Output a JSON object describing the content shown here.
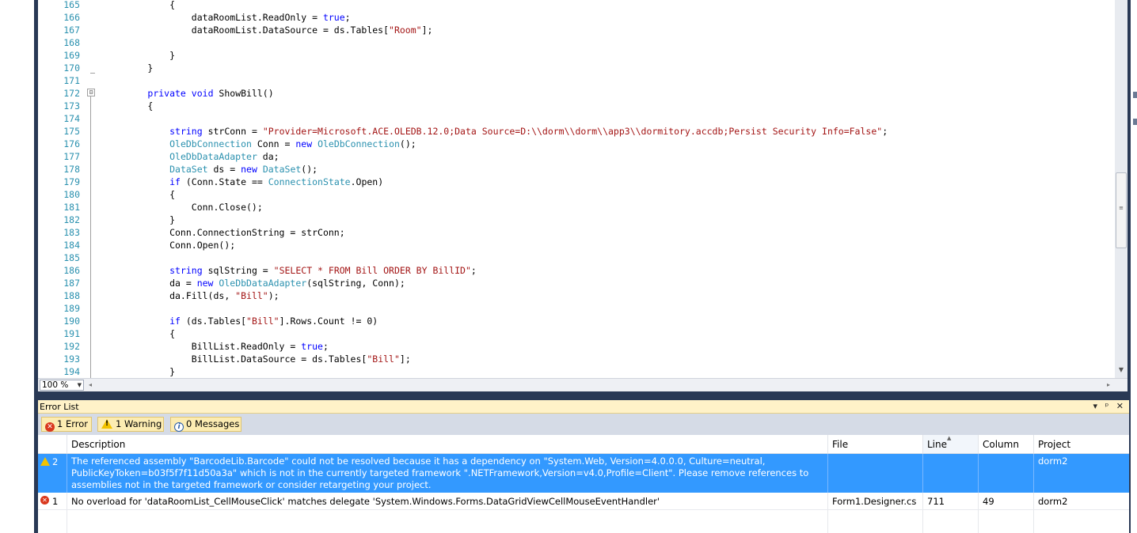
{
  "editor": {
    "lines": [
      {
        "n": "165",
        "tokens": [
          {
            "t": "            {",
            "c": "plain"
          }
        ]
      },
      {
        "n": "166",
        "tokens": [
          {
            "t": "                dataRoomList.ReadOnly = ",
            "c": "plain"
          },
          {
            "t": "true",
            "c": "kw"
          },
          {
            "t": ";",
            "c": "plain"
          }
        ]
      },
      {
        "n": "167",
        "tokens": [
          {
            "t": "                dataRoomList.DataSource = ds.Tables[",
            "c": "plain"
          },
          {
            "t": "\"Room\"",
            "c": "st"
          },
          {
            "t": "];",
            "c": "plain"
          }
        ]
      },
      {
        "n": "168",
        "tokens": []
      },
      {
        "n": "169",
        "tokens": [
          {
            "t": "            }",
            "c": "plain"
          }
        ]
      },
      {
        "n": "170",
        "tokens": [
          {
            "t": "        }",
            "c": "plain"
          }
        ]
      },
      {
        "n": "171",
        "tokens": []
      },
      {
        "n": "172",
        "tokens": [
          {
            "t": "        ",
            "c": "plain"
          },
          {
            "t": "private",
            "c": "kw"
          },
          {
            "t": " ",
            "c": "plain"
          },
          {
            "t": "void",
            "c": "kw"
          },
          {
            "t": " ShowBill()",
            "c": "plain"
          }
        ]
      },
      {
        "n": "173",
        "tokens": [
          {
            "t": "        {",
            "c": "plain"
          }
        ]
      },
      {
        "n": "174",
        "tokens": []
      },
      {
        "n": "175",
        "tokens": [
          {
            "t": "            ",
            "c": "plain"
          },
          {
            "t": "string",
            "c": "kw"
          },
          {
            "t": " strConn = ",
            "c": "plain"
          },
          {
            "t": "\"Provider=Microsoft.ACE.OLEDB.12.0;Data Source=D:\\\\dorm\\\\dorm\\\\app3\\\\dormitory.accdb;Persist Security Info=False\"",
            "c": "st"
          },
          {
            "t": ";",
            "c": "plain"
          }
        ]
      },
      {
        "n": "176",
        "tokens": [
          {
            "t": "            ",
            "c": "plain"
          },
          {
            "t": "OleDbConnection",
            "c": "ty"
          },
          {
            "t": " Conn = ",
            "c": "plain"
          },
          {
            "t": "new",
            "c": "kw"
          },
          {
            "t": " ",
            "c": "plain"
          },
          {
            "t": "OleDbConnection",
            "c": "ty"
          },
          {
            "t": "();",
            "c": "plain"
          }
        ]
      },
      {
        "n": "177",
        "tokens": [
          {
            "t": "            ",
            "c": "plain"
          },
          {
            "t": "OleDbDataAdapter",
            "c": "ty"
          },
          {
            "t": " da;",
            "c": "plain"
          }
        ]
      },
      {
        "n": "178",
        "tokens": [
          {
            "t": "            ",
            "c": "plain"
          },
          {
            "t": "DataSet",
            "c": "ty"
          },
          {
            "t": " ds = ",
            "c": "plain"
          },
          {
            "t": "new",
            "c": "kw"
          },
          {
            "t": " ",
            "c": "plain"
          },
          {
            "t": "DataSet",
            "c": "ty"
          },
          {
            "t": "();",
            "c": "plain"
          }
        ]
      },
      {
        "n": "179",
        "tokens": [
          {
            "t": "            ",
            "c": "plain"
          },
          {
            "t": "if",
            "c": "kw"
          },
          {
            "t": " (Conn.State == ",
            "c": "plain"
          },
          {
            "t": "ConnectionState",
            "c": "ty"
          },
          {
            "t": ".Open)",
            "c": "plain"
          }
        ]
      },
      {
        "n": "180",
        "tokens": [
          {
            "t": "            {",
            "c": "plain"
          }
        ]
      },
      {
        "n": "181",
        "tokens": [
          {
            "t": "                Conn.Close();",
            "c": "plain"
          }
        ]
      },
      {
        "n": "182",
        "tokens": [
          {
            "t": "            }",
            "c": "plain"
          }
        ]
      },
      {
        "n": "183",
        "tokens": [
          {
            "t": "            Conn.ConnectionString = strConn;",
            "c": "plain"
          }
        ]
      },
      {
        "n": "184",
        "tokens": [
          {
            "t": "            Conn.Open();",
            "c": "plain"
          }
        ]
      },
      {
        "n": "185",
        "tokens": []
      },
      {
        "n": "186",
        "tokens": [
          {
            "t": "            ",
            "c": "plain"
          },
          {
            "t": "string",
            "c": "kw"
          },
          {
            "t": " sqlString = ",
            "c": "plain"
          },
          {
            "t": "\"SELECT * FROM Bill ORDER BY BillID\"",
            "c": "st"
          },
          {
            "t": ";",
            "c": "plain"
          }
        ]
      },
      {
        "n": "187",
        "tokens": [
          {
            "t": "            da = ",
            "c": "plain"
          },
          {
            "t": "new",
            "c": "kw"
          },
          {
            "t": " ",
            "c": "plain"
          },
          {
            "t": "OleDbDataAdapter",
            "c": "ty"
          },
          {
            "t": "(sqlString, Conn);",
            "c": "plain"
          }
        ]
      },
      {
        "n": "188",
        "tokens": [
          {
            "t": "            da.Fill(ds, ",
            "c": "plain"
          },
          {
            "t": "\"Bill\"",
            "c": "st"
          },
          {
            "t": ");",
            "c": "plain"
          }
        ]
      },
      {
        "n": "189",
        "tokens": []
      },
      {
        "n": "190",
        "tokens": [
          {
            "t": "            ",
            "c": "plain"
          },
          {
            "t": "if",
            "c": "kw"
          },
          {
            "t": " (ds.Tables[",
            "c": "plain"
          },
          {
            "t": "\"Bill\"",
            "c": "st"
          },
          {
            "t": "].Rows.Count != 0)",
            "c": "plain"
          }
        ]
      },
      {
        "n": "191",
        "tokens": [
          {
            "t": "            {",
            "c": "plain"
          }
        ]
      },
      {
        "n": "192",
        "tokens": [
          {
            "t": "                BillList.ReadOnly = ",
            "c": "plain"
          },
          {
            "t": "true",
            "c": "kw"
          },
          {
            "t": ";",
            "c": "plain"
          }
        ]
      },
      {
        "n": "193",
        "tokens": [
          {
            "t": "                BillList.DataSource = ds.Tables[",
            "c": "plain"
          },
          {
            "t": "\"Bill\"",
            "c": "st"
          },
          {
            "t": "];",
            "c": "plain"
          }
        ]
      },
      {
        "n": "194",
        "tokens": [
          {
            "t": "            }",
            "c": "plain"
          }
        ]
      }
    ],
    "zoom": "100 %",
    "collapse_symbol": "⊟"
  },
  "error_list": {
    "title": "Error List",
    "title_buttons": "▾ ᵖ ✕",
    "filters": {
      "errors": "1 Error",
      "warnings": "1 Warning",
      "messages": "0 Messages"
    },
    "columns": {
      "description": "Description",
      "file": "File",
      "line": "Line",
      "column": "Column",
      "project": "Project"
    },
    "rows": [
      {
        "type": "warning",
        "num": "2",
        "description": "The referenced assembly \"BarcodeLib.Barcode\" could not be resolved because it has a dependency on \"System.Web, Version=4.0.0.0, Culture=neutral, PublicKeyToken=b03f5f7f11d50a3a\" which is not in the currently targeted framework \".NETFramework,Version=v4.0,Profile=Client\". Please remove references to assemblies not in the targeted framework or consider retargeting your project.",
        "file": "",
        "line": "",
        "column": "",
        "project": "dorm2"
      },
      {
        "type": "error",
        "num": "1",
        "description": "No overload for 'dataRoomList_CellMouseClick' matches delegate 'System.Windows.Forms.DataGridViewCellMouseEventHandler'",
        "file": "Form1.Designer.cs",
        "line": "711",
        "column": "49",
        "project": "dorm2"
      }
    ]
  },
  "colors": {
    "frame": "#293955",
    "keyword": "#0000ff",
    "type": "#2b91af",
    "string": "#a31515",
    "selection": "#3399ff",
    "title_bar": "#fff2c8"
  }
}
